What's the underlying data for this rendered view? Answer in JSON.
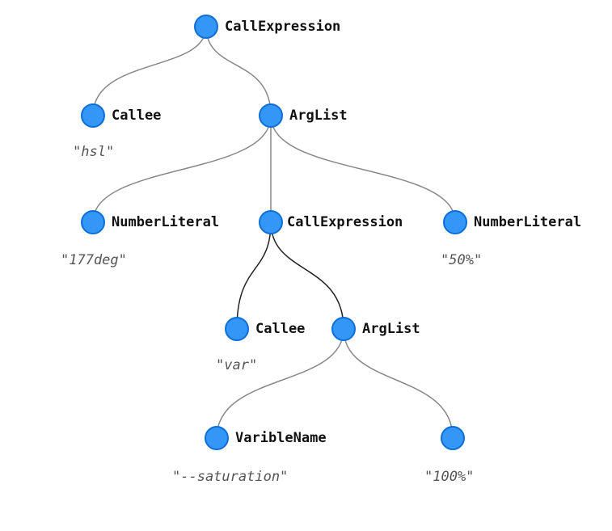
{
  "chart_data": {
    "type": "tree",
    "root": {
      "label": "CallExpression",
      "children": [
        {
          "label": "Callee",
          "value": "\"hsl\""
        },
        {
          "label": "ArgList",
          "children": [
            {
              "label": "NumberLiteral",
              "value": "\"177deg\""
            },
            {
              "label": "CallExpression",
              "children": [
                {
                  "label": "Callee",
                  "value": "\"var\""
                },
                {
                  "label": "ArgList",
                  "children": [
                    {
                      "label": "VaribleName",
                      "value": "\"--saturation\""
                    },
                    {
                      "label": "",
                      "value": "\"100%\""
                    }
                  ]
                }
              ]
            },
            {
              "label": "NumberLiteral",
              "value": "\"50%\""
            }
          ]
        }
      ]
    }
  },
  "nodes": {
    "root": {
      "label": "CallExpression"
    },
    "callee1": {
      "label": "Callee",
      "value": "\"hsl\""
    },
    "arg1": {
      "label": "ArgList"
    },
    "num1": {
      "label": "NumberLiteral",
      "value": "\"177deg\""
    },
    "call2": {
      "label": "CallExpression"
    },
    "num2": {
      "label": "NumberLiteral",
      "value": "\"50%\""
    },
    "callee2": {
      "label": "Callee",
      "value": "\"var\""
    },
    "arg2": {
      "label": "ArgList"
    },
    "varname": {
      "label": "VaribleName",
      "value": "\"--saturation\""
    },
    "pct": {
      "label": "",
      "value": "\"100%\""
    }
  }
}
